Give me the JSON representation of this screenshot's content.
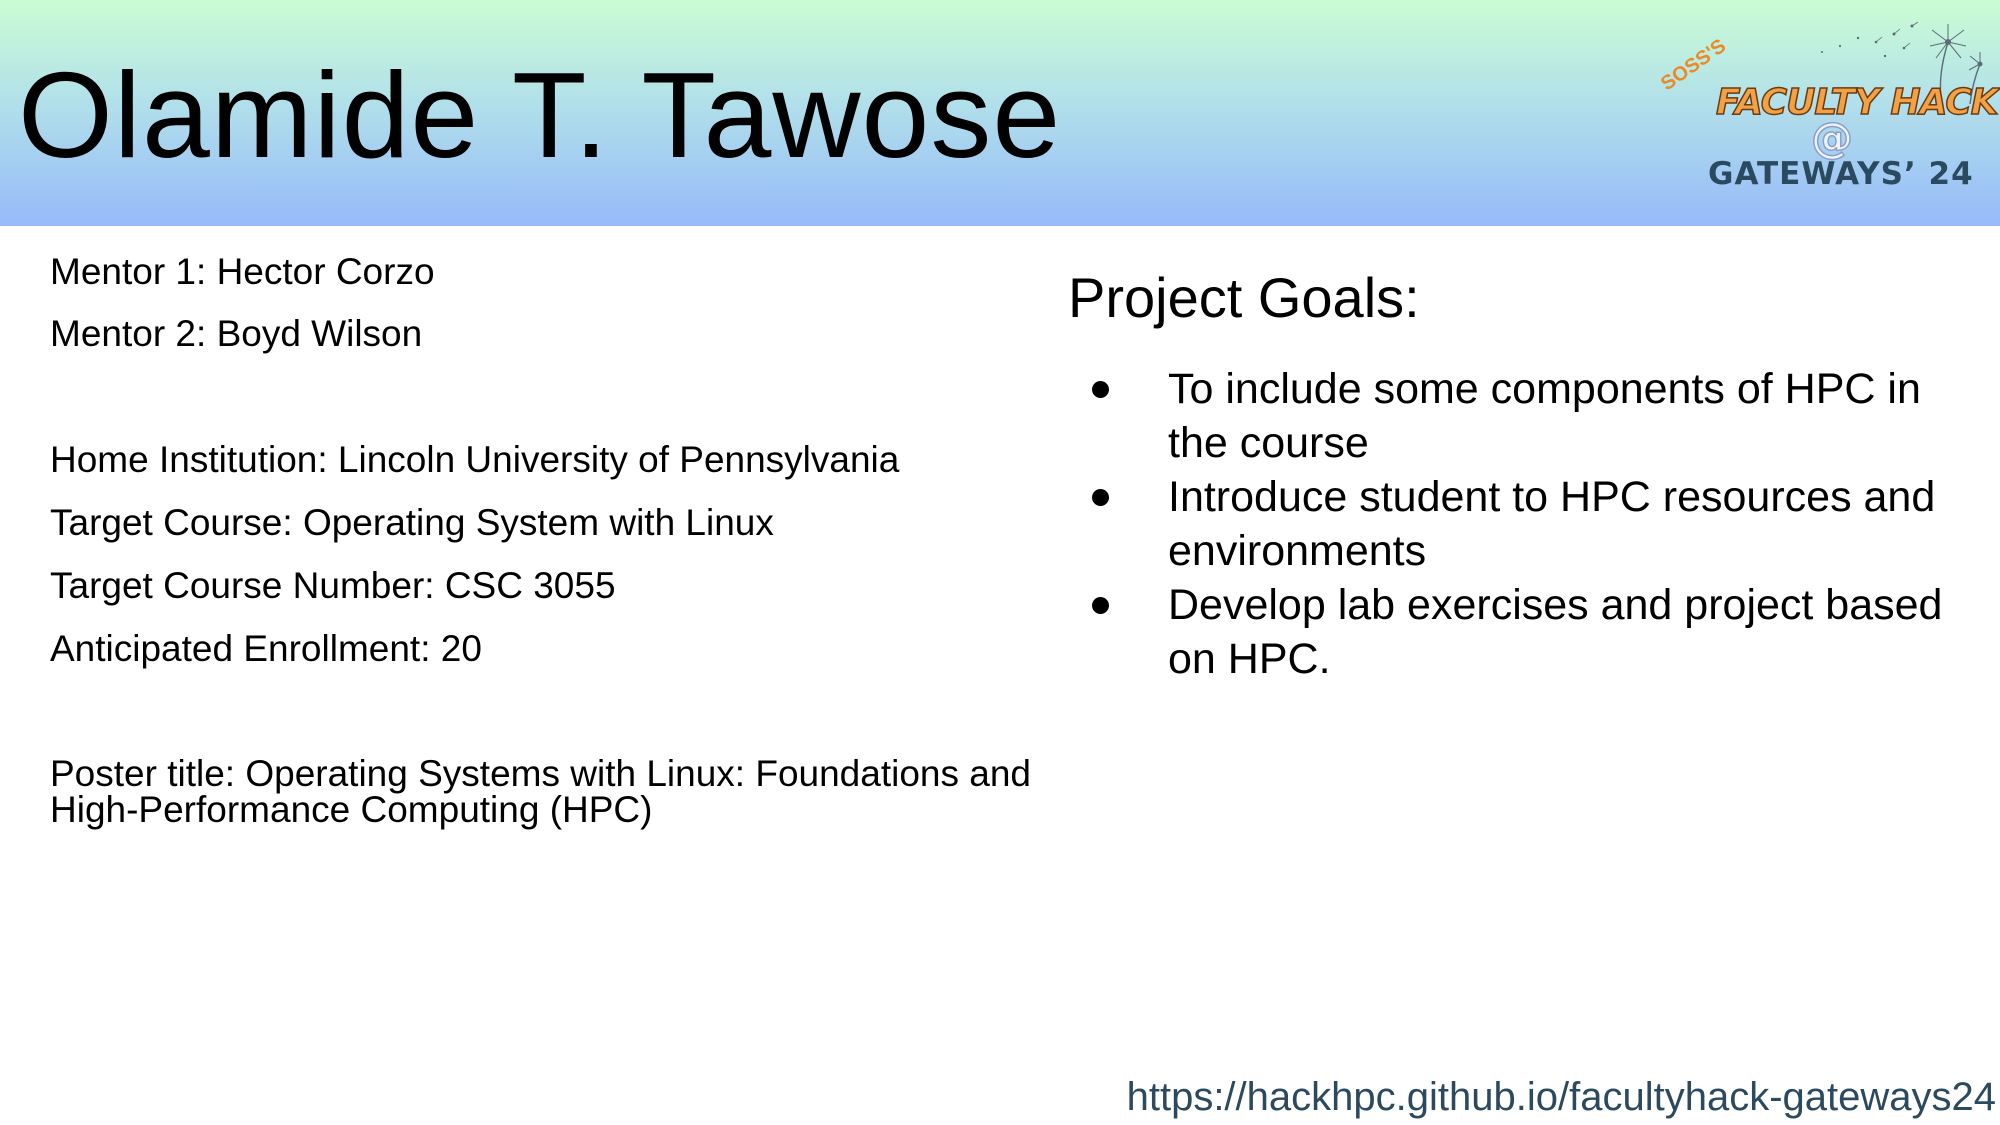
{
  "slide": {
    "title": "Olamide T. Tawose"
  },
  "logo": {
    "prefix": "SOSS'S",
    "wordmark": "FACULTY HACK",
    "at_symbol": "@",
    "event": "GATEWAYS’ 24",
    "colors": {
      "wordmark": "#f2a144",
      "event": "#2c4a5f"
    }
  },
  "details": {
    "mentor_1": "Mentor 1: Hector Corzo",
    "mentor_2": "Mentor 2: Boyd Wilson",
    "home_institution": "Home Institution: Lincoln University of Pennsylvania",
    "target_course": "Target Course: Operating System with Linux",
    "course_number": "Target Course Number: CSC 3055",
    "enrollment": "Anticipated Enrollment: 20",
    "poster_title": "Poster title: Operating Systems with Linux: Foundations and High-Performance Computing (HPC)"
  },
  "goals": {
    "heading": "Project Goals:",
    "items": [
      "To include some components of HPC in the course",
      "Introduce student to HPC resources and environments",
      "Develop lab exercises and project based on HPC."
    ]
  },
  "footer": {
    "url": "https://hackhpc.github.io/facultyhack-gateways24"
  },
  "colors": {
    "header_gradient_top": "#cbfdd4",
    "header_gradient_bottom": "#96baf9",
    "link": "#2c4a5f"
  }
}
